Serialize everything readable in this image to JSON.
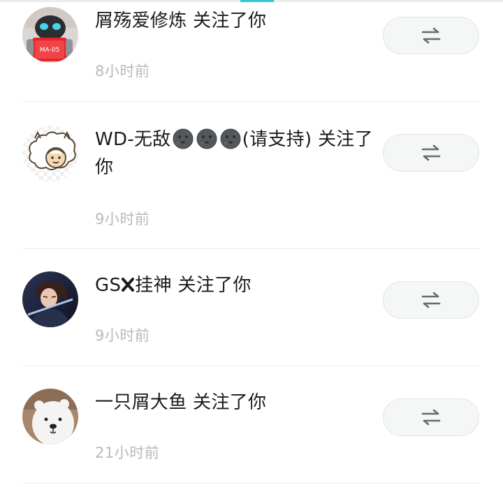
{
  "notifications": [
    {
      "user_name": "屑殇爱修炼",
      "action_text": " 关注了你",
      "time": "8小时前",
      "avatar_icon": "robot-avatar",
      "follow_icon": "mutual-follow-arrows-icon"
    },
    {
      "user_name_prefix": "WD-无敌",
      "emoji": "new-moon-face-emoji",
      "emoji_count": 3,
      "user_name_suffix": "(请支持)",
      "action_text": " 关注了你",
      "time": "9小时前",
      "avatar_icon": "sheep-avatar",
      "follow_icon": "mutual-follow-arrows-icon"
    },
    {
      "user_name_prefix": "GS",
      "mark_icon": "cross-mark",
      "user_name_suffix": "挂神",
      "action_text": " 关注了你",
      "time": "9小时前",
      "avatar_icon": "anime-character-avatar",
      "follow_icon": "mutual-follow-arrows-icon"
    },
    {
      "user_name": "一只屑大鱼",
      "action_text": " 关注了你",
      "time": "21小时前",
      "avatar_icon": "polar-bear-avatar",
      "follow_icon": "mutual-follow-arrows-icon"
    }
  ],
  "colors": {
    "accent": "#32c6d6",
    "text_primary": "#1b1b1b",
    "text_secondary": "#b9b9b9",
    "button_bg": "#f5f6f6",
    "divider": "#ececec"
  }
}
